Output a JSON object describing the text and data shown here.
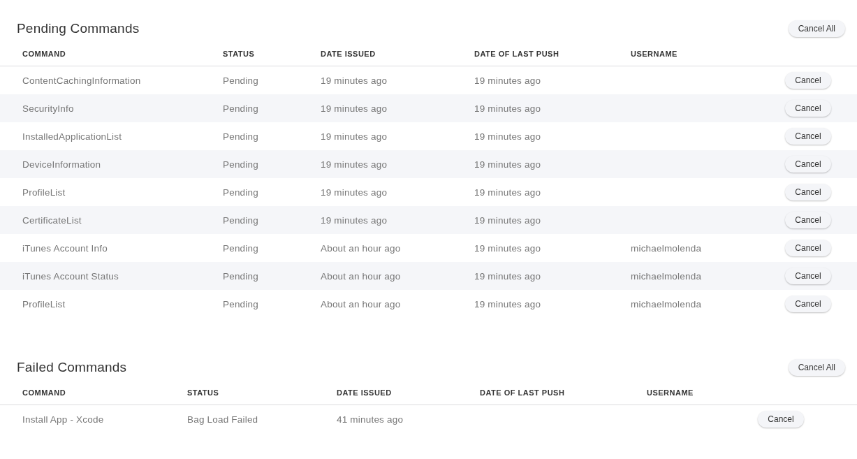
{
  "sections": [
    {
      "title": "Pending Commands",
      "cancel_all": "Cancel All",
      "columns": [
        "COMMAND",
        "STATUS",
        "DATE ISSUED",
        "DATE OF LAST PUSH",
        "USERNAME"
      ],
      "rows": [
        {
          "command": "ContentCachingInformation",
          "status": "Pending",
          "date_issued": "19 minutes ago",
          "last_push": "19 minutes ago",
          "action": "Cancel"
        },
        {
          "command": "SecurityInfo",
          "status": "Pending",
          "date_issued": "19 minutes ago",
          "last_push": "19 minutes ago",
          "action": "Cancel"
        },
        {
          "command": "InstalledApplicationList",
          "status": "Pending",
          "date_issued": "19 minutes ago",
          "last_push": "19 minutes ago",
          "action": "Cancel"
        },
        {
          "command": "DeviceInformation",
          "status": "Pending",
          "date_issued": "19 minutes ago",
          "last_push": "19 minutes ago",
          "action": "Cancel"
        },
        {
          "command": "ProfileList",
          "status": "Pending",
          "date_issued": "19 minutes ago",
          "last_push": "19 minutes ago",
          "action": "Cancel"
        },
        {
          "command": "CertificateList",
          "status": "Pending",
          "date_issued": "19 minutes ago",
          "last_push": "19 minutes ago",
          "action": "Cancel"
        },
        {
          "command": "iTunes Account Info",
          "status": "Pending",
          "date_issued": "About an hour ago",
          "last_push": "19 minutes ago",
          "username": "michaelmolenda",
          "action": "Cancel"
        },
        {
          "command": "iTunes Account Status",
          "status": "Pending",
          "date_issued": "About an hour ago",
          "last_push": "19 minutes ago",
          "username": "michaelmolenda",
          "action": "Cancel"
        },
        {
          "command": "ProfileList",
          "status": "Pending",
          "date_issued": "About an hour ago",
          "last_push": "19 minutes ago",
          "username": "michaelmolenda",
          "action": "Cancel"
        }
      ]
    },
    {
      "title": "Failed Commands",
      "cancel_all": "Cancel All",
      "columns": [
        "COMMAND",
        "STATUS",
        "DATE ISSUED",
        "DATE OF LAST PUSH",
        "USERNAME"
      ],
      "rows": [
        {
          "command": "Install App - Xcode",
          "status": "Bag Load Failed",
          "date_issued": "41 minutes ago",
          "action": "Cancel"
        }
      ]
    }
  ]
}
